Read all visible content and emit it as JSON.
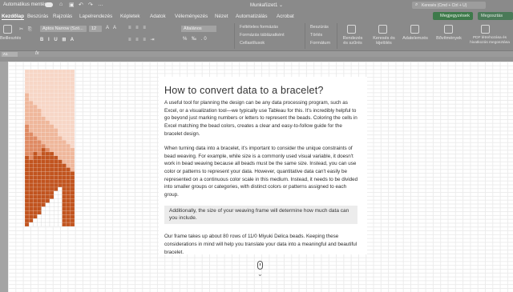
{
  "titlebar": {
    "autosave_label": "Automatikus mentés",
    "workbook_title": "Munkafüzet1 ⌄",
    "search_placeholder": "Keresés (Cmd + Ctrl + U)"
  },
  "tabs": [
    {
      "label": "Kezdőlap",
      "active": true
    },
    {
      "label": "Beszúrás"
    },
    {
      "label": "Rajzolás"
    },
    {
      "label": "Lapelrendezés"
    },
    {
      "label": "Képletek"
    },
    {
      "label": "Adatok"
    },
    {
      "label": "Véleményezés"
    },
    {
      "label": "Nézet"
    },
    {
      "label": "Automatizálás"
    },
    {
      "label": "Acrobat"
    }
  ],
  "buttons": {
    "comments": "Megjegyzések",
    "share": "Megosztás"
  },
  "ribbon": {
    "paste": "Beillesztés",
    "font_name": "Aptos Narrow (Szö...",
    "font_size": "12",
    "alignment": "Általános",
    "conditional_format": "Feltételes formázás",
    "format_as_table": "Formázás táblázatként",
    "cell_styles": "Cellastílusok",
    "insert": "Beszúrás",
    "delete": "Törlés",
    "format": "Formátum",
    "sort_filter": "Rendezés és szűrés",
    "find_select": "Keresés és kijelölés",
    "analyze": "Adatelemzés",
    "addins": "Bővítmények",
    "pdf": "PDF létrehozása és hivatkozás megosztása"
  },
  "formula_bar": {
    "cell_ref": "A1",
    "fx": "fx"
  },
  "article": {
    "title": "How to convert data to a bracelet?",
    "paragraph1": "A useful tool for planning the design can be any data processing program, such as Excel, or a visualization tool—we typically use Tableau for this. It's incredibly helpful to go beyond just marking numbers or letters to represent the beads. Coloring the cells in Excel matching the bead colors, creates a clear and easy-to-follow guide for the bracelet design.",
    "paragraph2": "When turning data into a bracelet, it's important to consider the unique constraints of bead weaving. For example, while size is a commonly used visual variable, it doesn't work in bead weaving because all beads must be the same size. Instead, you can use color or patterns to represent your data. However, quantitative data can't easily be represented on a continuous color scale in this medium. Instead, it needs to be divided into smaller groups or categories, with distinct colors or patterns assigned to each group.",
    "callout": "Additionally, the size of your weaving frame will determine how much data can you include.",
    "paragraph3": "Our frame takes up about 80 rows of 11/0 Miyuki Delica beads. Keeping these considerations in mind will help you translate your data into a meaningful and beautiful bracelet."
  },
  "colors": {
    "chrome": "#8a8a8a",
    "bead_lightest": "#f7d6c6",
    "bead_light": "#efb79b",
    "bead_mid": "#df8a63",
    "bead_dark": "#c1541f"
  }
}
